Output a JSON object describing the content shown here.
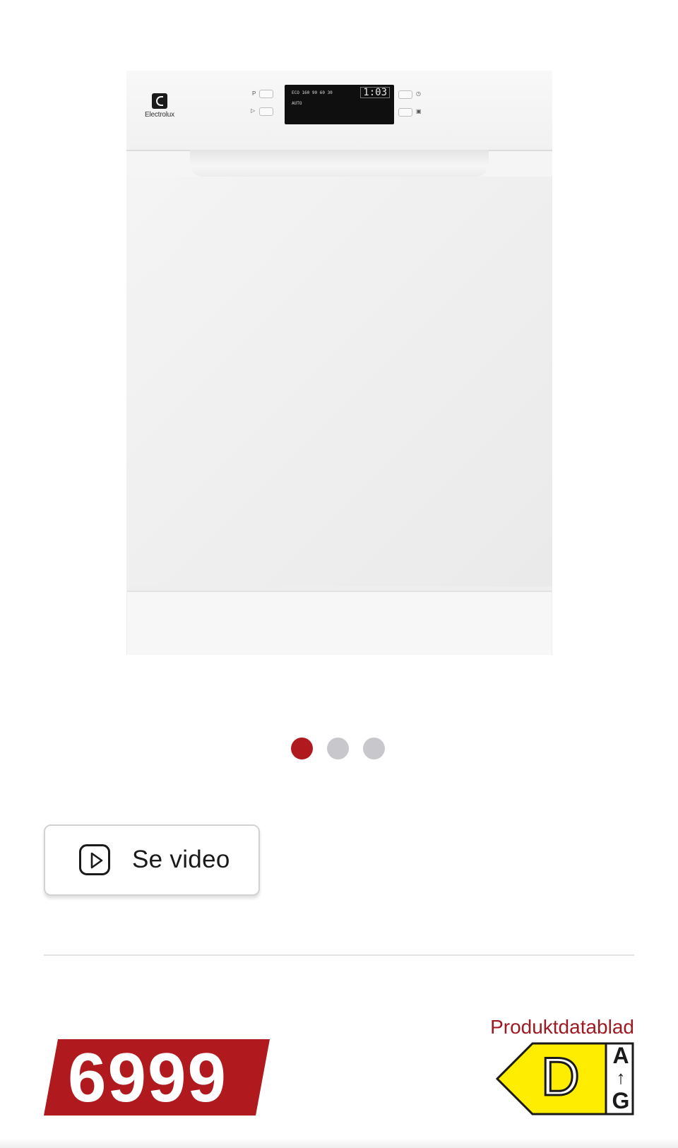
{
  "product_image": {
    "brand": "Electrolux",
    "panel": {
      "program_label": "P",
      "start_label": "▷",
      "lcd_row1": "ECO  160  90  60  30",
      "lcd_row2": "AUTO",
      "lcd_digits": "1:03"
    }
  },
  "carousel": {
    "dots": [
      {
        "active": true
      },
      {
        "active": false
      },
      {
        "active": false
      }
    ]
  },
  "video_button": {
    "label": "Se video",
    "icon": "play-icon"
  },
  "price": {
    "value": "6999",
    "background_color": "#b0191e"
  },
  "datasheet": {
    "label": "Produktdatablad",
    "color": "#9c1b22"
  },
  "energy_label": {
    "class": "D",
    "scale_top": "A",
    "scale_arrow": "↑",
    "scale_bottom": "G",
    "color": "#ffed00"
  }
}
